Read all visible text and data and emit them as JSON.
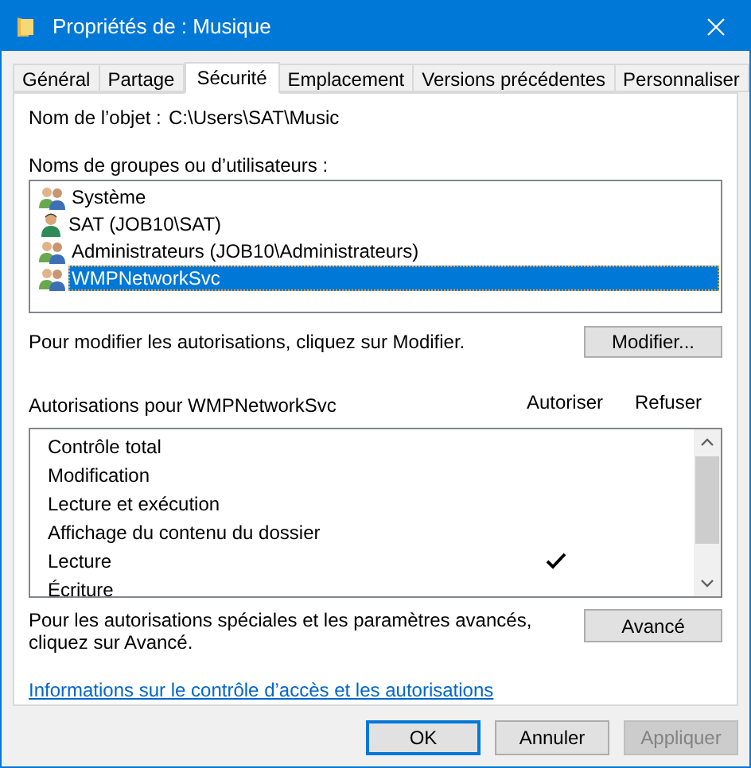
{
  "window": {
    "title": "Propriétés de : Musique"
  },
  "tabs": [
    {
      "label": "Général",
      "selected": false
    },
    {
      "label": "Partage",
      "selected": false
    },
    {
      "label": "Sécurité",
      "selected": true
    },
    {
      "label": "Emplacement",
      "selected": false
    },
    {
      "label": "Versions précédentes",
      "selected": false
    },
    {
      "label": "Personnaliser",
      "selected": false
    }
  ],
  "object_name": {
    "label": "Nom de l’objet :",
    "value": "C:\\Users\\SAT\\Music"
  },
  "users": {
    "label": "Noms de groupes ou d’utilisateurs :",
    "items": [
      {
        "name": "Système",
        "kind": "group",
        "selected": false
      },
      {
        "name": "SAT (JOB10\\SAT)",
        "kind": "user",
        "selected": false
      },
      {
        "name": "Administrateurs (JOB10\\Administrateurs)",
        "kind": "group",
        "selected": false
      },
      {
        "name": "WMPNetworkSvc",
        "kind": "group",
        "selected": true
      }
    ]
  },
  "modify": {
    "hint": "Pour modifier les autorisations, cliquez sur Modifier.",
    "button": "Modifier..."
  },
  "permissions": {
    "label": "Autorisations pour WMPNetworkSvc",
    "allow_header": "Autoriser",
    "deny_header": "Refuser",
    "items": [
      {
        "name": "Contrôle total",
        "allow": false,
        "deny": false
      },
      {
        "name": "Modification",
        "allow": false,
        "deny": false
      },
      {
        "name": "Lecture et exécution",
        "allow": false,
        "deny": false
      },
      {
        "name": "Affichage du contenu du dossier",
        "allow": false,
        "deny": false
      },
      {
        "name": "Lecture",
        "allow": true,
        "deny": false
      },
      {
        "name": "Écriture",
        "allow": false,
        "deny": false
      }
    ]
  },
  "advanced": {
    "hint": "Pour les autorisations spéciales et les paramètres avancés, cliquez sur Avancé.",
    "button": "Avancé"
  },
  "link": "Informations sur le contrôle d’accès et les autorisations",
  "buttons": [
    {
      "label": "OK",
      "default": true,
      "disabled": false
    },
    {
      "label": "Annuler",
      "default": false,
      "disabled": false
    },
    {
      "label": "Appliquer",
      "default": false,
      "disabled": true
    }
  ]
}
